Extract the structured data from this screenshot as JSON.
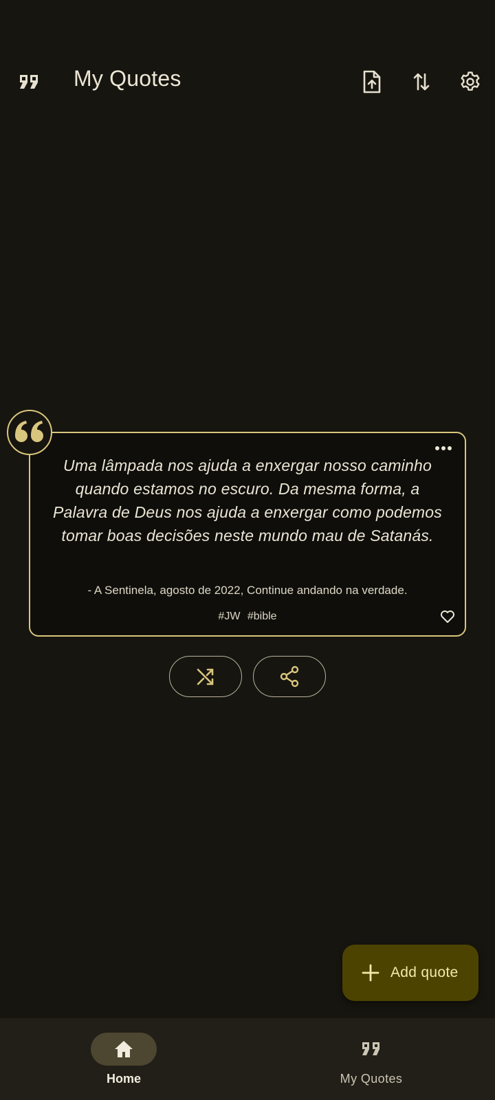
{
  "header": {
    "title": "My Quotes",
    "icons": [
      "quote-icon",
      "file-upload-icon",
      "swap-vertical-icon",
      "gear-icon"
    ]
  },
  "quote": {
    "text": "Uma lâmpada nos ajuda a enxergar nosso caminho quando estamos no escuro. Da mesma forma, a Palavra de Deus nos ajuda a enxergar como podemos tomar boas decisões neste mundo mau de Satanás.",
    "source": "- A Sentinela, agosto de 2022, Continue andando na verdade.",
    "tags": [
      "#JW",
      "#bible"
    ],
    "favorite": false
  },
  "actions": {
    "shuffle_icon": "shuffle-icon",
    "share_icon": "share-icon"
  },
  "fab": {
    "label": "Add quote"
  },
  "bottom_nav": {
    "items": [
      {
        "label": "Home",
        "icon": "home-icon",
        "active": true
      },
      {
        "label": "My Quotes",
        "icon": "quote-icon",
        "active": false
      }
    ]
  },
  "colors": {
    "background": "#17150f",
    "accent": "#d9c67e",
    "fab_background": "#4c4300",
    "nav_background": "#211f18"
  }
}
